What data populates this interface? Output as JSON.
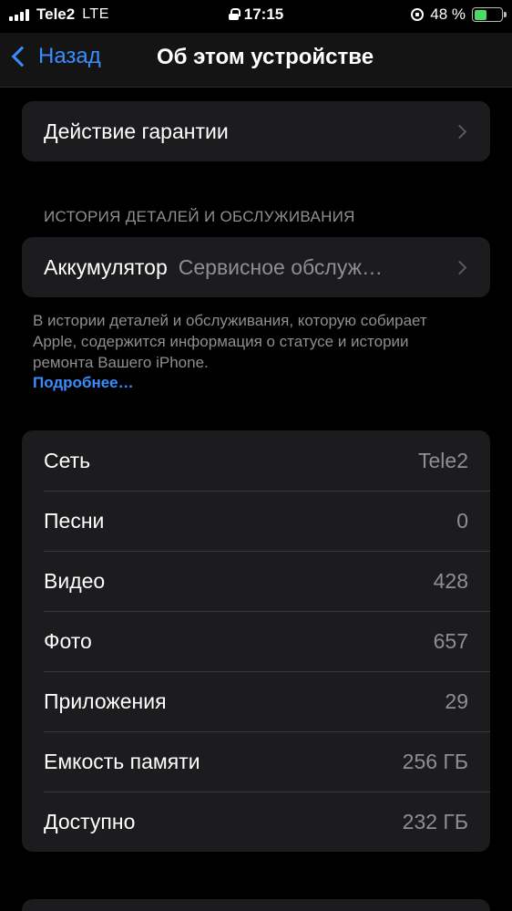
{
  "status_bar": {
    "carrier": "Tele2",
    "network": "LTE",
    "time": "17:15",
    "battery": "48 %",
    "battery_level": 0.48
  },
  "nav": {
    "back_label": "Назад",
    "title": "Об этом устройстве"
  },
  "warranty": {
    "label": "Действие гарантии"
  },
  "history": {
    "header": "ИСТОРИЯ ДЕТАЛЕЙ И ОБСЛУЖИВАНИЯ",
    "battery_label": "Аккумулятор",
    "battery_value": "Сервисное обслуж…",
    "footer": "В истории деталей и обслуживания, которую собирает Apple, содержится информация о статусе и истории ремонта Вашего iPhone.",
    "more_link": "Подробнее…"
  },
  "info": {
    "rows": [
      {
        "label": "Сеть",
        "value": "Tele2"
      },
      {
        "label": "Песни",
        "value": "0"
      },
      {
        "label": "Видео",
        "value": "428"
      },
      {
        "label": "Фото",
        "value": "657"
      },
      {
        "label": "Приложения",
        "value": "29"
      },
      {
        "label": "Емкость памяти",
        "value": "256 ГБ"
      },
      {
        "label": "Доступно",
        "value": "232 ГБ"
      }
    ]
  }
}
